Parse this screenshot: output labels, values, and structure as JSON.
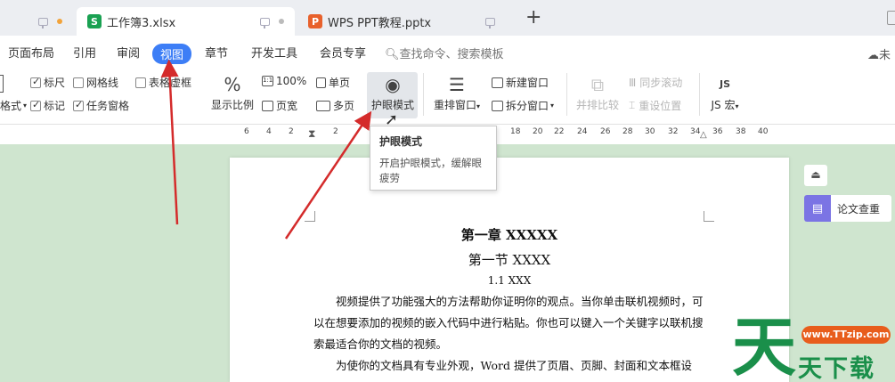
{
  "tabs": [
    {
      "label": "",
      "icon": "monitor-icon",
      "dot_color": "#f2a33a"
    },
    {
      "label": "工作簿3.xlsx",
      "icon_letter": "S"
    },
    {
      "label": "WPS PPT教程.pptx",
      "icon_letter": "P"
    }
  ],
  "menu": {
    "items": [
      "页面布局",
      "引用",
      "审阅",
      "视图",
      "章节",
      "开发工具",
      "会员专享"
    ],
    "active": "视图",
    "search": "查找命令、搜索模板",
    "cloud": "未"
  },
  "ribbon": {
    "col1": [
      "格式"
    ],
    "checks": [
      {
        "label": "标尺",
        "checked": true
      },
      {
        "label": "网格线",
        "checked": false
      },
      {
        "label": "表格虚框",
        "checked": false
      },
      {
        "label": "标记",
        "checked": true
      },
      {
        "label": "任务窗格",
        "checked": true
      }
    ],
    "zoom_label": "显示比例",
    "zoom100": "100%",
    "page_width": "页宽",
    "single_page": "单页",
    "multi_page": "多页",
    "eye_mode": "护眼模式",
    "rearrange": "重排窗口",
    "new_window": "新建窗口",
    "split_window": "拆分窗口",
    "side_by_side": "并排比较",
    "sync_scroll": "同步滚动",
    "reset_pos": "重设位置",
    "js_macro": "JS 宏"
  },
  "ruler": {
    "ticks": [
      "6",
      "4",
      "2",
      "2",
      "18",
      "20",
      "22",
      "24",
      "26",
      "28",
      "30",
      "32",
      "34",
      "36",
      "38",
      "40"
    ]
  },
  "tooltip": {
    "title": "护眼模式",
    "desc": "开启护眼模式，缓解眼疲劳"
  },
  "document": {
    "heading1": "第一章  XXXXX",
    "heading2": "第一节  XXXX",
    "heading3": "1.1 XXX",
    "para1": "视频提供了功能强大的方法帮助你证明你的观点。当你单击联机视频时，可以在想要添加的视频的嵌入代码中进行粘贴。你也可以键入一个关键字以联机搜索最适合你的文档的视频。",
    "para2": "为使你的文档具有专业外观，Word 提供了页眉、页脚、封面和文本框设"
  },
  "side": {
    "thesis_check": "论文查重"
  },
  "watermark": {
    "url": "www.TTzip.com",
    "big": "天",
    "text": "天下载"
  },
  "colors": {
    "accent": "#3d7ef6",
    "arrow": "#d42b2b",
    "doc_bg": "#cfe5cf",
    "thesis_icon": "#7b74e4"
  }
}
